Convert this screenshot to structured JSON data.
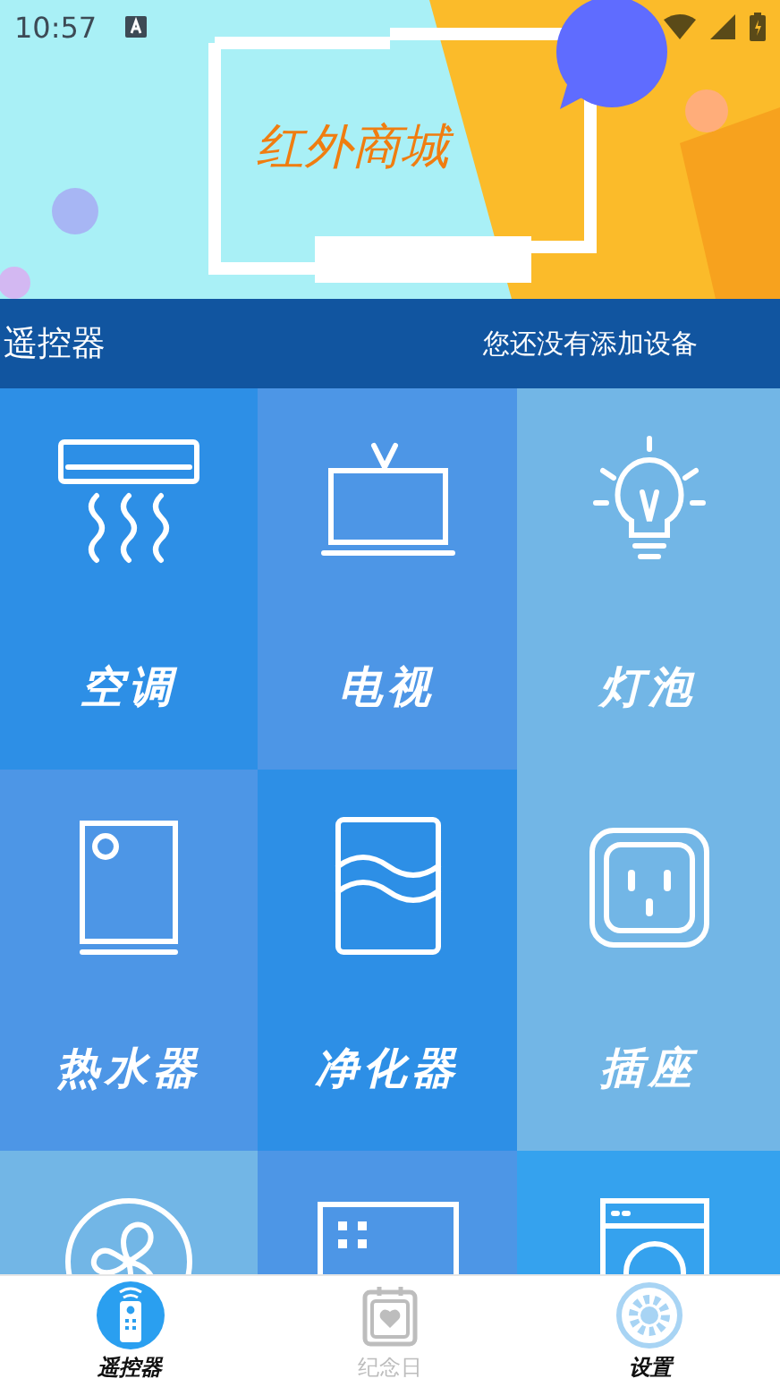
{
  "status_bar": {
    "time": "10:57"
  },
  "banner": {
    "title": "红外商城"
  },
  "header": {
    "title": "遥控器",
    "message": "您还没有添加设备"
  },
  "devices": [
    {
      "kind": "ac",
      "label": "空调"
    },
    {
      "kind": "tv",
      "label": "电视"
    },
    {
      "kind": "bulb",
      "label": "灯泡"
    },
    {
      "kind": "heater",
      "label": "热水器"
    },
    {
      "kind": "purifier",
      "label": "净化器"
    },
    {
      "kind": "socket",
      "label": "插座"
    },
    {
      "kind": "fan"
    },
    {
      "kind": "box"
    },
    {
      "kind": "washer"
    }
  ],
  "tabs": [
    {
      "kind": "remote",
      "label": "遥控器",
      "selected": true,
      "bold": true
    },
    {
      "kind": "calendar",
      "label": "纪念日",
      "selected": false,
      "bold": false
    },
    {
      "kind": "gear",
      "label": "设置",
      "selected": false,
      "bold": true
    }
  ]
}
